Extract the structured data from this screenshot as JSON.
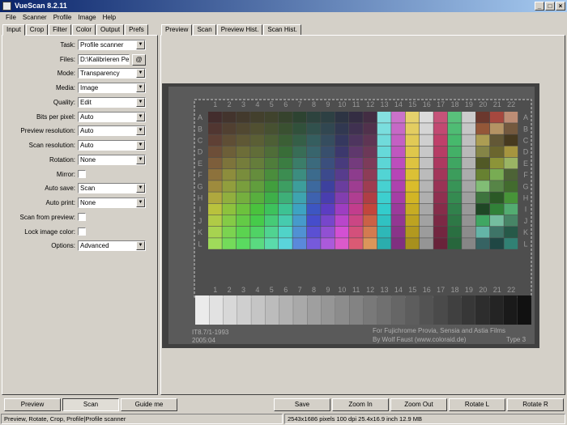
{
  "window": {
    "title": "VueScan 8.2.11"
  },
  "menu": [
    "File",
    "Scanner",
    "Profile",
    "Image",
    "Help"
  ],
  "left_tabs": [
    "Input",
    "Crop",
    "Filter",
    "Color",
    "Output",
    "Prefs"
  ],
  "right_tabs": [
    "Preview",
    "Scan",
    "Preview Hist.",
    "Scan Hist."
  ],
  "options": {
    "task": {
      "label": "Task:",
      "value": "Profile scanner"
    },
    "files": {
      "label": "Files:",
      "value": "D:\\Kalibrieren Peni",
      "button": "@"
    },
    "mode": {
      "label": "Mode:",
      "value": "Transparency"
    },
    "media": {
      "label": "Media:",
      "value": "Image"
    },
    "quality": {
      "label": "Quality:",
      "value": "Edit"
    },
    "bits": {
      "label": "Bits per pixel:",
      "value": "Auto"
    },
    "preview_res": {
      "label": "Preview resolution:",
      "value": "Auto"
    },
    "scan_res": {
      "label": "Scan resolution:",
      "value": "Auto"
    },
    "rotation": {
      "label": "Rotation:",
      "value": "None"
    },
    "mirror": {
      "label": "Mirror:",
      "checked": false
    },
    "auto_save": {
      "label": "Auto save:",
      "value": "Scan"
    },
    "auto_print": {
      "label": "Auto print:",
      "value": "None"
    },
    "scan_from_preview": {
      "label": "Scan from preview:",
      "checked": false
    },
    "lock_image_color": {
      "label": "Lock image color:",
      "checked": false
    },
    "opts": {
      "label": "Options:",
      "value": "Advanced"
    }
  },
  "target": {
    "columns": [
      "1",
      "2",
      "3",
      "4",
      "5",
      "6",
      "7",
      "8",
      "9",
      "10",
      "11",
      "12",
      "13",
      "14",
      "15",
      "16",
      "17",
      "18",
      "19",
      "20",
      "21",
      "22"
    ],
    "rows": [
      "A",
      "B",
      "C",
      "D",
      "E",
      "F",
      "G",
      "H",
      "I",
      "J",
      "K",
      "L"
    ],
    "label_left": "IT8.7/1-1993",
    "label_left2": "2005:04",
    "label_right": "For Fujichrome Provia, Sensia and Astia Films",
    "label_right2": "By Wolf Faust (www.coloraid.de)",
    "label_right3": "Type 3"
  },
  "buttons": [
    "Preview",
    "Scan",
    "Guide me",
    "Save",
    "Zoom In",
    "Zoom Out",
    "Rotate L",
    "Rotate R"
  ],
  "status": {
    "left": "Preview, Rotate, Crop, Profile|Profile scanner",
    "right": "2543x1686 pixels 100 dpi 25.4x16.9 inch 12.9 MB"
  }
}
